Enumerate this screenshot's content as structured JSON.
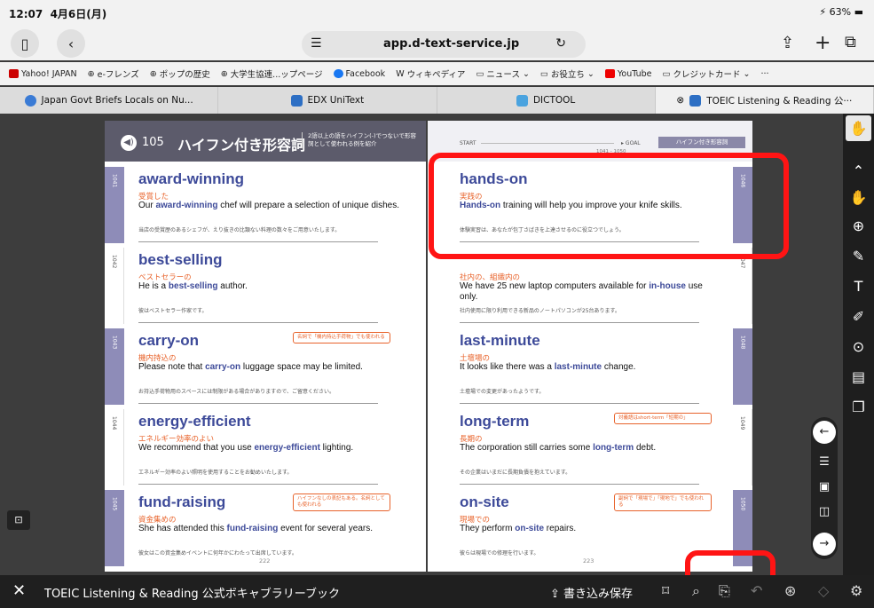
{
  "status": {
    "time": "12:07",
    "date": "4月6日(月)",
    "battery": "63%"
  },
  "browser": {
    "url": "app.d-text-service.jp",
    "bookmarks": [
      "Yahoo! JAPAN",
      "e-フレンズ",
      "ポップの歴史",
      "大学生協連...ップページ",
      "Facebook",
      "ウィキペディア",
      "ニュース",
      "お役立ち",
      "YouTube",
      "クレジットカード"
    ],
    "tabs": [
      "Japan Govt Briefs Locals on Nu...",
      "EDX UniText",
      "DICTOOL",
      "TOEIC Listening & Reading 公···"
    ]
  },
  "book": {
    "left_header": {
      "audio": "105",
      "title": "ハイフン付き形容詞",
      "subtitle": "2語以上の語をハイフン(-)でつないで形容詞として使われる例を紹介"
    },
    "right_header": {
      "start": "START",
      "goal": "GOAL",
      "range": "1041 - 1050",
      "pill": "ハイフン付き形容詞"
    },
    "left_entries": [
      {
        "no": "1041",
        "word": "award-winning",
        "ja": "受賞した",
        "s_pre": "Our ",
        "s_hl": "award-winning",
        "s_post": " chef will prepare a selection of unique dishes.",
        "tr": "当店の受賞歴のあるシェフが、えり抜きの比類ない料理の数々をご用意いたします。",
        "note": ""
      },
      {
        "no": "1042",
        "word": "best-selling",
        "ja": "ベストセラーの",
        "s_pre": "He is a ",
        "s_hl": "best-selling",
        "s_post": " author.",
        "tr": "彼はベストセラー作家です。",
        "note": ""
      },
      {
        "no": "1043",
        "word": "carry-on",
        "ja": "機内持込の",
        "s_pre": "Please note that ",
        "s_hl": "carry-on",
        "s_post": " luggage space may be limited.",
        "tr": "お持込手荷物用のスペースには制限がある場合がありますので、ご留意ください。",
        "note": "名詞で「機内持込手荷物」でも使われる"
      },
      {
        "no": "1044",
        "word": "energy-efficient",
        "ja": "エネルギー効率のよい",
        "s_pre": "We recommend that you use ",
        "s_hl": "energy-efficient",
        "s_post": " lighting.",
        "tr": "エネルギー効率のよい照明を使用することをお勧めいたします。",
        "note": ""
      },
      {
        "no": "1045",
        "word": "fund-raising",
        "ja": "資金集めの",
        "s_pre": "She has attended this ",
        "s_hl": "fund-raising",
        "s_post": " event for several years.",
        "tr": "彼女はこの資金集めイベントに何年かにわたって出席しています。",
        "note": "ハイフンなしの表記もある。名詞としても使われる"
      }
    ],
    "right_entries": [
      {
        "no": "1046",
        "word": "hands-on",
        "ja": "実践の",
        "s_pre": "",
        "s_hl": "Hands-on",
        "s_post": " training will help you improve your knife skills.",
        "tr": "体験実習は、あなたが包丁さばきを上達させるのに役立つでしょう。",
        "note": ""
      },
      {
        "no": "1047",
        "word": "",
        "ja": "社内の、組織内の",
        "s_pre": "We have 25 new laptop computers available for ",
        "s_hl": "in-house",
        "s_post": " use only.",
        "tr": "社内使用に限り利用できる新品のノートパソコンが25台あります。",
        "note": ""
      },
      {
        "no": "1048",
        "word": "last-minute",
        "ja": "土壇場の",
        "s_pre": "It looks like there was a ",
        "s_hl": "last-minute",
        "s_post": " change.",
        "tr": "土壇場での変更があったようです。",
        "note": ""
      },
      {
        "no": "1049",
        "word": "long-term",
        "ja": "長期の",
        "s_pre": "The corporation still carries some ",
        "s_hl": "long-term",
        "s_post": " debt.",
        "tr": "その企業はいまだに長期負債を抱えています。",
        "note": "対義語はshort-term「短期の」"
      },
      {
        "no": "1050",
        "word": "on-site",
        "ja": "現場での",
        "s_pre": "They perform ",
        "s_hl": "on-site",
        "s_post": " repairs.",
        "tr": "彼らは現場での修理を行います。",
        "note": "副詞で「現場で」「現地で」でも使われる"
      }
    ],
    "page_left": "222",
    "page_right": "223"
  },
  "bottom": {
    "title": "TOEIC Listening & Reading 公式ボキャブラリーブック",
    "save": "書き込み保存"
  }
}
